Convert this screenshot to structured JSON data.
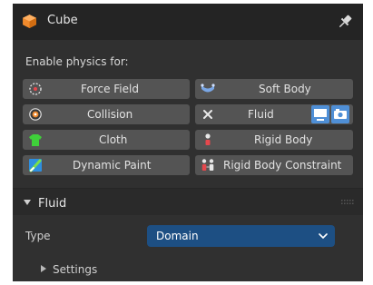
{
  "header": {
    "title": "Cube",
    "icon": "cube-icon",
    "pin_icon": "pin-icon"
  },
  "physics": {
    "enable_label": "Enable physics for:",
    "buttons": [
      {
        "label": "Force Field",
        "icon": "force-field-icon"
      },
      {
        "label": "Soft Body",
        "icon": "soft-body-icon"
      },
      {
        "label": "Collision",
        "icon": "collision-icon"
      },
      {
        "label": "Fluid",
        "icon": "close-x-icon",
        "active": true
      },
      {
        "label": "Cloth",
        "icon": "cloth-icon"
      },
      {
        "label": "Rigid Body",
        "icon": "rigid-body-icon"
      },
      {
        "label": "Dynamic Paint",
        "icon": "dynamic-paint-icon"
      },
      {
        "label": "Rigid Body Constraint",
        "icon": "rigid-body-constraint-icon"
      }
    ]
  },
  "fluid_panel": {
    "title": "Fluid",
    "type_label": "Type",
    "type_value": "Domain",
    "settings_label": "Settings"
  },
  "colors": {
    "panel_bg": "#303030",
    "header_bg": "#242424",
    "button_bg": "#545454",
    "dropdown_bg": "#1d4f83",
    "accent_blue": "#4f8fd6"
  }
}
